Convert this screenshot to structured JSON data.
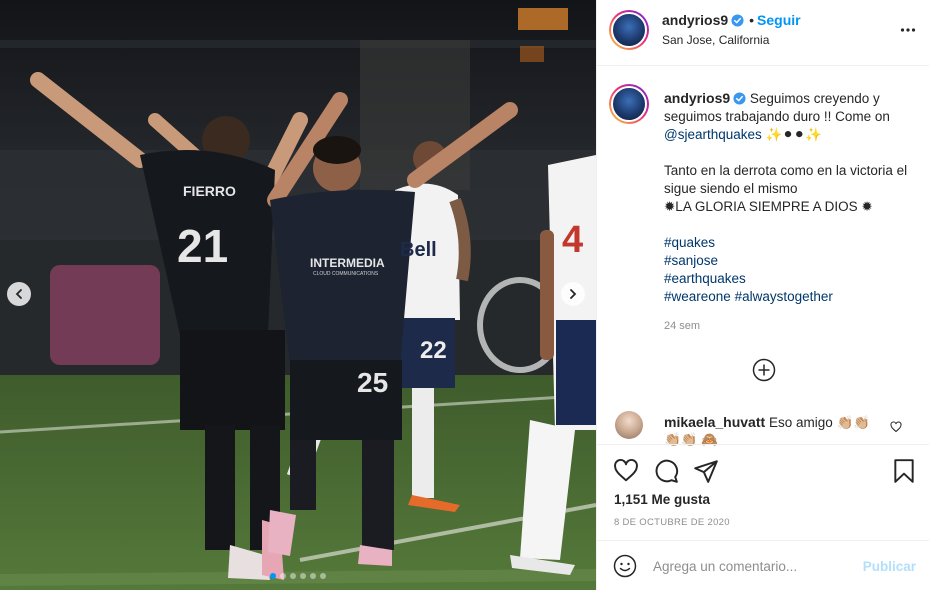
{
  "post": {
    "photo": {
      "jersey_left_name": "FIERRO",
      "jersey_left_number": "21",
      "jersey_center_number": "25",
      "jersey_center_sponsor": "INTERMEDIA",
      "jersey_center_sponsor_sub": "CLOUD COMMUNICATIONS",
      "jersey_white_number": "22",
      "jersey_right_number": "4",
      "jersey_white_sponsor": "Bell",
      "carousel_dots": 6,
      "carousel_active_index": 0
    },
    "header": {
      "username": "andyrios9",
      "separator": "•",
      "follow_label": "Seguir",
      "location": "San Jose, California"
    },
    "caption": {
      "username": "andyrios9",
      "line1": "Seguimos creyendo y seguimos trabajando duro !! Come on",
      "mention": "@sjearthquakes",
      "mention_suffix": " ✨⚫⚫✨",
      "line2": "Tanto en la derrota como en la victoria el sigue siendo el mismo",
      "line3": "✹LA GLORIA SIEMPRE A DIOS ✹",
      "hashtags": [
        "#quakes",
        "#sanjose",
        "#earthquakes",
        "#weareone",
        "#alwaystogether"
      ],
      "time_ago": "24 sem"
    },
    "comment": {
      "username": "mikaela_huvatt",
      "text": "Eso amigo 👏🏼👏🏼👏🏼👏🏼 🙈"
    },
    "likes": "1,151 Me gusta",
    "date": "8 DE OCTUBRE DE 2020",
    "add_comment": {
      "placeholder": "Agrega un comentario...",
      "publish_label": "Publicar"
    },
    "colors": {
      "accent": "#0095f6",
      "link": "#00376b",
      "publish_disabled": "#b2dffc",
      "quakes_blue": "#1d2330"
    }
  }
}
